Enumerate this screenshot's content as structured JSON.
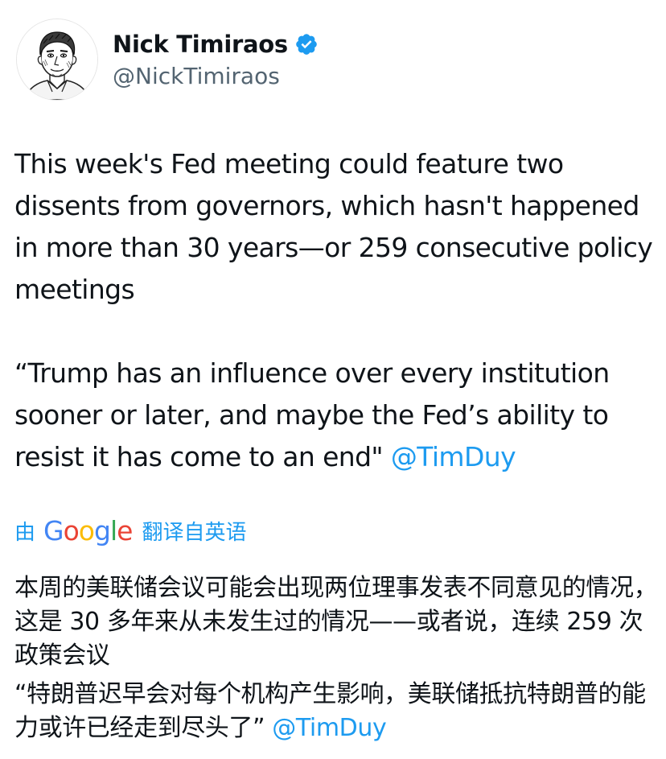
{
  "author": {
    "display_name": "Nick Timiraos",
    "handle": "@NickTimiraos",
    "verified_icon": "verified-badge-icon",
    "verified_color": "#1d9bf0"
  },
  "tweet": {
    "paragraph_1": "This week's Fed meeting could feature two dissents from governors, which hasn't happened in more than 30 years—or 259 consecutive policy meetings",
    "paragraph_2_quote": "“Trump has an influence over every institution sooner or later, and maybe the Fed’s ability to resist it has come to an end\"",
    "paragraph_2_mention": "@TimDuy"
  },
  "translation": {
    "prefix": "由",
    "provider": "Google",
    "suffix": "翻译自英语",
    "paragraph_1": "本周的美联储会议可能会出现两位理事发表不同意见的情况，这是 30 多年来从未发生过的情况——或者说，连续 259 次政策会议",
    "paragraph_2_quote": "“特朗普迟早会对每个机构产生影响，美联储抵抗特朗普的能力或许已经走到尽头了”",
    "paragraph_2_mention": "@TimDuy"
  },
  "colors": {
    "link": "#1d9bf0",
    "text": "#0f1419",
    "secondary_text": "#536471",
    "google_blue": "#4285f4",
    "google_red": "#ea4335",
    "google_yellow": "#fbbc05",
    "google_green": "#34a853"
  }
}
